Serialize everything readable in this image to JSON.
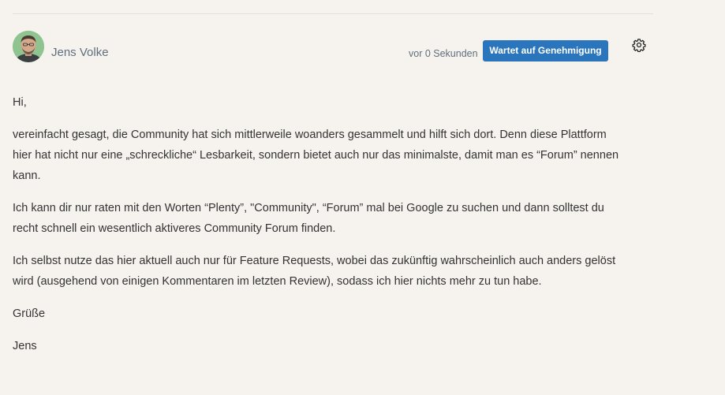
{
  "post": {
    "author": {
      "name": "Jens Volke",
      "avatar_icon": "user-avatar"
    },
    "timestamp": "vor 0 Sekunden",
    "status_badge": "Wartet auf Genehmigung",
    "settings_icon": "gear-icon",
    "paragraphs": [
      "Hi,",
      "vereinfacht gesagt, die Community hat sich mittlerweile woanders gesammelt und hilft sich dort. Denn diese Plattform hier hat nicht nur eine „schreckliche“ Lesbarkeit, sondern bietet auch nur das minimalste, damit man es “Forum” nennen kann.",
      "Ich kann dir nur raten mit den Worten “Plenty”, \"Community\", “Forum” mal bei Google zu suchen und dann solltest du recht schnell ein wesentlich aktiveres Community Forum finden.",
      "Ich selbst nutze das hier aktuell auch nur für Feature Requests, wobei das zukünftig wahrscheinlich auch anders gelöst wird (ausgehend von einigen Kommentaren im letzten Review), sodass ich hier nichts mehr zu tun habe.",
      "Grüße",
      "Jens"
    ]
  },
  "colors": {
    "background": "#f6f3ef",
    "badge": "#2a75bb",
    "meta_text": "#5e6f7d",
    "body_text": "#333333"
  }
}
